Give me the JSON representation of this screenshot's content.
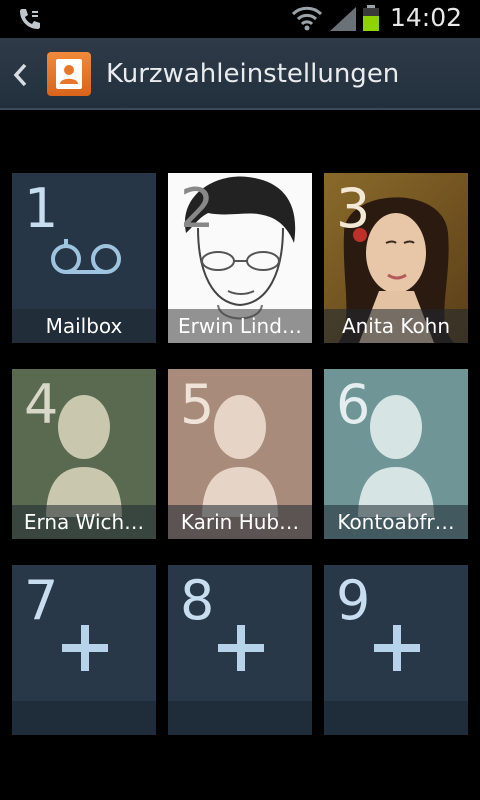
{
  "status_bar": {
    "time": "14:02"
  },
  "action_bar": {
    "title": "Kurzwahleinstellungen"
  },
  "tiles": [
    {
      "number": "1",
      "name": "Mailbox"
    },
    {
      "number": "2",
      "name": "Erwin Lind…"
    },
    {
      "number": "3",
      "name": "Anita Kohn"
    },
    {
      "number": "4",
      "name": "Erna Wich…"
    },
    {
      "number": "5",
      "name": "Karin Hub…"
    },
    {
      "number": "6",
      "name": "Kontoabfr…"
    },
    {
      "number": "7",
      "name": ""
    },
    {
      "number": "8",
      "name": ""
    },
    {
      "number": "9",
      "name": ""
    }
  ],
  "colors": {
    "tile_mailbox": "#263646",
    "tile_contact4": "#5a6a50",
    "tile_contact5": "#a88b7a",
    "tile_contact6": "#6f9597",
    "tile_empty": "#283848",
    "accent_orange": "#e8762a"
  },
  "icons": {
    "status_phone": "phone-icon",
    "status_wifi": "wifi-icon",
    "status_signal": "signal-icon",
    "status_battery": "battery-icon",
    "back": "back-arrow-icon",
    "app": "contacts-icon",
    "voicemail": "voicemail-icon",
    "add": "plus-icon"
  }
}
